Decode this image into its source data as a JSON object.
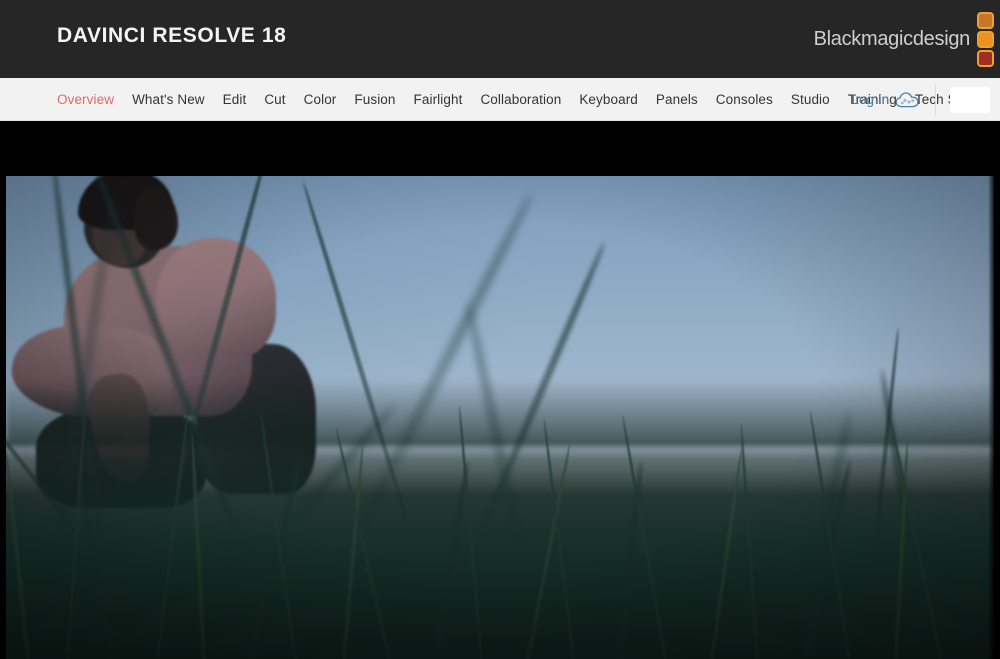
{
  "header": {
    "product_title": "DAVINCI RESOLVE 18",
    "brand_wordmark": "Blackmagicdesign",
    "background_color": "#262626",
    "title_color": "#f4f4f4",
    "logo_square_colors": [
      "#c8762c",
      "#f09020",
      "#9e2f22"
    ],
    "logo_border_color": "#f0a030"
  },
  "nav": {
    "background_color": "#f2f2f2",
    "link_color": "#343434",
    "active_color": "#e06a66",
    "items": [
      {
        "label": "Overview",
        "active": true
      },
      {
        "label": "What's New",
        "active": false
      },
      {
        "label": "Edit",
        "active": false
      },
      {
        "label": "Cut",
        "active": false
      },
      {
        "label": "Color",
        "active": false
      },
      {
        "label": "Fusion",
        "active": false
      },
      {
        "label": "Fairlight",
        "active": false
      },
      {
        "label": "Collaboration",
        "active": false
      },
      {
        "label": "Keyboard",
        "active": false
      },
      {
        "label": "Panels",
        "active": false
      },
      {
        "label": "Consoles",
        "active": false
      },
      {
        "label": "Studio",
        "active": false
      },
      {
        "label": "Training",
        "active": false
      },
      {
        "label": "Tech Specs",
        "active": false
      }
    ],
    "login": {
      "label": "Log In",
      "color": "#4a7fa8",
      "icon": "cloud-icon"
    },
    "account_button": {
      "label": "",
      "color": "#ffffff"
    }
  },
  "hero": {
    "alt": "Man crouching in a tall grass field at dusk, shot through out-of-focus grass blades",
    "sky_top_color": "#7d9cbd",
    "sky_horizon_color": "#c6c4d0",
    "grass_color": "#16302a",
    "frame_background": "#000000"
  }
}
